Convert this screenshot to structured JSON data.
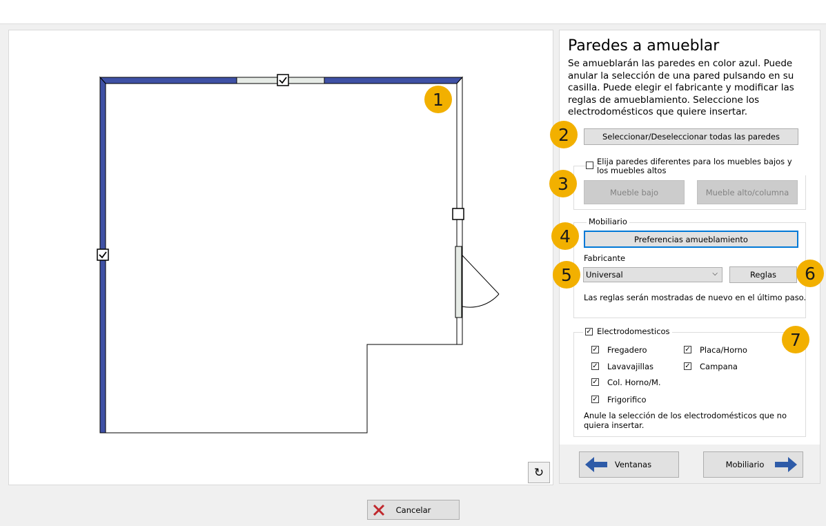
{
  "panel": {
    "title": "Paredes a amueblar",
    "description": "Se amueblarán las paredes en color azul. Puede anular la selección de una pared pulsando en su casilla. Puede elegir el fabricante y modificar las reglas de amueblamiento. Seleccione los electrodomésticos que quiere insertar.",
    "select_all_label": "Seleccionar/Deseleccionar todas las paredes",
    "different_walls_label": "Elija paredes diferentes para los muebles bajos y los muebles altos",
    "mueble_bajo_label": "Mueble bajo",
    "mueble_alto_label": "Mueble alto/columna",
    "mobiliario_group_label": "Mobiliario",
    "preferencias_label": "Preferencias amueblamiento",
    "fabricante_label": "Fabricante",
    "fabricante_value": "Universal",
    "reglas_label": "Reglas",
    "reglas_note": "Las reglas serán mostradas de nuevo en el último paso.",
    "electro_label": "Electrodomesticos",
    "appliances": [
      "Fregadero",
      "Placa/Horno",
      "Lavavajillas",
      "Campana",
      "Col. Horno/M.",
      "Frigorifico"
    ],
    "appliances_note": "Anule la selección de los electrodomésticos que no quiera insertar."
  },
  "nav": {
    "back_label": "Ventanas",
    "next_label": "Mobiliario"
  },
  "footer": {
    "cancel_label": "Cancelar"
  },
  "badges": [
    "1",
    "2",
    "3",
    "4",
    "5",
    "6",
    "7"
  ],
  "colors": {
    "wall_selected": "#3f51a5",
    "badge": "#f2b000",
    "arrow": "#2e5ba8",
    "cancel_x": "#c0282d",
    "focus": "#0078d7"
  }
}
